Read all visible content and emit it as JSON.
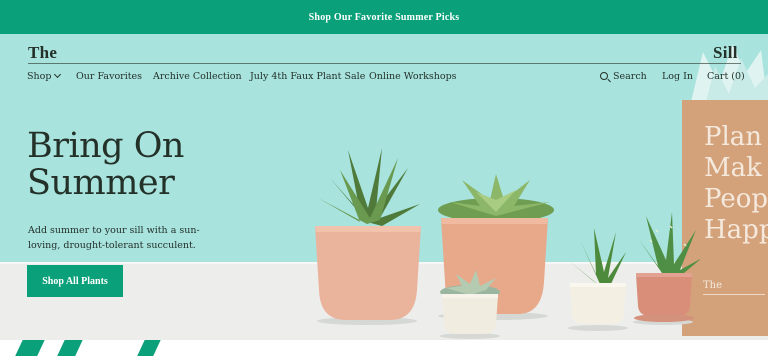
{
  "promo": {
    "text": "Shop Our Favorite Summer Picks"
  },
  "header": {
    "logo_left": "The",
    "logo_right": "Sill",
    "nav": {
      "shop": "Shop",
      "favorites": "Our Favorites",
      "archive": "Archive Collection",
      "sale": "July 4th Faux Plant Sale",
      "workshops": "Online Workshops",
      "search": "Search",
      "login": "Log In",
      "cart": "Cart (0)"
    }
  },
  "hero": {
    "headline_line1": "Bring On",
    "headline_line2": "Summer",
    "subtext": "Add summer to your sill with a sun-loving, drought-tolerant succulent.",
    "cta": "Shop All Plants"
  },
  "bag": {
    "lines": [
      "Plan",
      "Mak",
      "Peop",
      "Happ"
    ],
    "brand": "The"
  },
  "colors": {
    "accent": "#09a07a",
    "hero_bg": "#a8e3de",
    "text": "#233129"
  }
}
